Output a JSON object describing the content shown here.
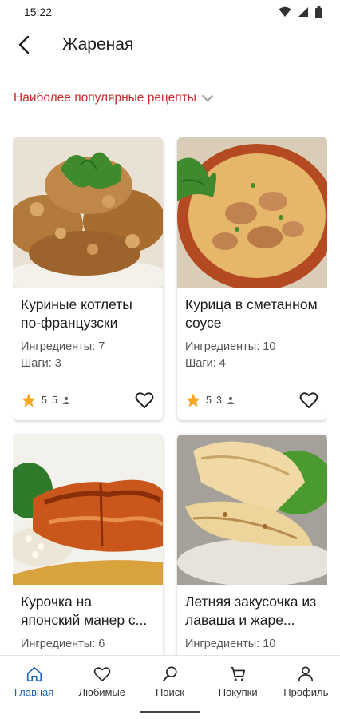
{
  "status_bar": {
    "time": "15:22",
    "icons": [
      "wifi-icon",
      "signal-icon",
      "battery-icon"
    ]
  },
  "header": {
    "title": "Жареная",
    "back_icon": "arrow-back-icon"
  },
  "filter": {
    "label": "Наиболее популярные рецепты",
    "icon": "chevron-down-icon",
    "color": "#c62828"
  },
  "recipes": [
    {
      "title": "Куриные котлеты по-французски",
      "ingredients": "Ингредиенты: 7",
      "steps": "Шаги: 3",
      "rating": "5",
      "reviews": "5",
      "favorite": false
    },
    {
      "title": "Курица в сметанном соусе",
      "ingredients": "Ингредиенты: 10",
      "steps": "Шаги: 4",
      "rating": "5",
      "reviews": "3",
      "favorite": false
    },
    {
      "title": "Курочка на японский манер с...",
      "ingredients": "Ингредиенты: 6",
      "steps": "",
      "rating": "",
      "reviews": "",
      "favorite": false
    },
    {
      "title": "Летняя закусочка из лаваша и жаре...",
      "ingredients": "Ингредиенты: 10",
      "steps": "",
      "rating": "",
      "reviews": "",
      "favorite": false
    }
  ],
  "bottom_nav": [
    {
      "label": "Главная",
      "icon": "home-icon",
      "active": true
    },
    {
      "label": "Любимые",
      "icon": "heart-icon",
      "active": false
    },
    {
      "label": "Поиск",
      "icon": "search-icon",
      "active": false
    },
    {
      "label": "Покупки",
      "icon": "cart-icon",
      "active": false
    },
    {
      "label": "Профиль",
      "icon": "person-icon",
      "active": false
    }
  ],
  "colors": {
    "accent": "#1e62b4",
    "star": "#f5a623",
    "filter_text": "#c62828"
  }
}
